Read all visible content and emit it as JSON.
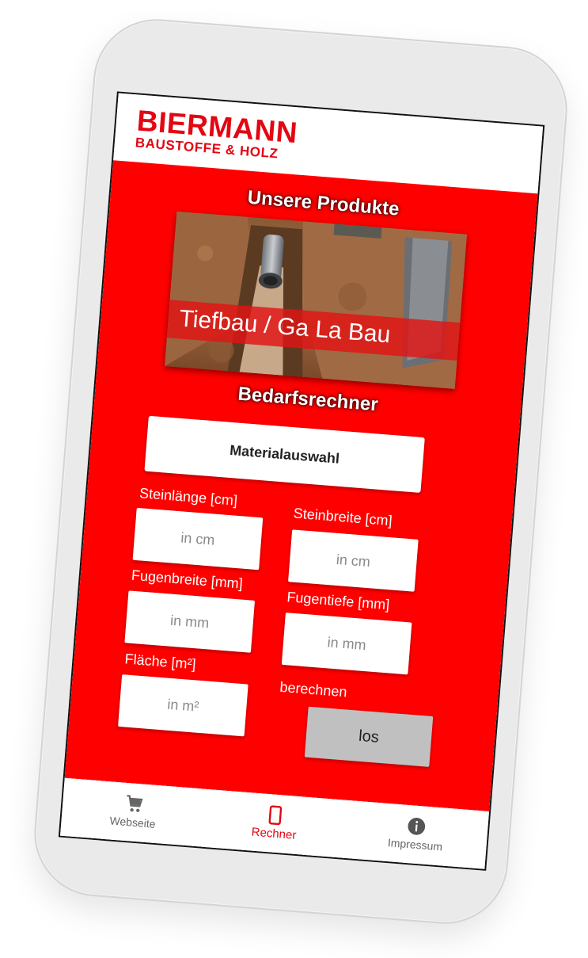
{
  "brand": {
    "name": "BIERMANN",
    "tagline": "BAUSTOFFE & HOLZ",
    "color": "#e30613"
  },
  "theme": {
    "content_background": "#ff0000",
    "button_gray": "#c0c0c0"
  },
  "products": {
    "title": "Unsere Produkte",
    "banner_caption": "Tiefbau / Ga La Bau"
  },
  "calculator": {
    "title": "Bedarfsrechner",
    "material_button": "Materialauswahl",
    "fields": {
      "stone_length": {
        "label": "Steinlänge [cm]",
        "placeholder": "in cm"
      },
      "stone_width": {
        "label": "Steinbreite [cm]",
        "placeholder": "in cm"
      },
      "joint_width": {
        "label": "Fugenbreite [mm]",
        "placeholder": "in mm"
      },
      "joint_depth": {
        "label": "Fugentiefe [mm]",
        "placeholder": "in mm"
      },
      "area": {
        "label": "Fläche [m²]",
        "placeholder": "in m²"
      }
    },
    "calculate_label": "berechnen",
    "calculate_button": "los"
  },
  "nav": {
    "items": [
      {
        "label": "Webseite",
        "icon": "cart-icon",
        "active": false
      },
      {
        "label": "Rechner",
        "icon": "phone-icon",
        "active": true
      },
      {
        "label": "Impressum",
        "icon": "info-icon",
        "active": false
      }
    ]
  }
}
